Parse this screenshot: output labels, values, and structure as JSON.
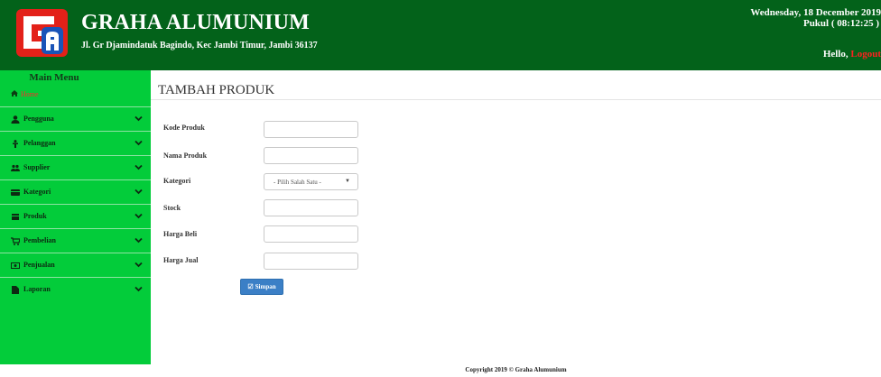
{
  "header": {
    "logo_icon": "graha-alumunium-logo",
    "title": "GRAHA ALUMUNIUM",
    "address": "Jl. Gr Djamindatuk Bagindo, Kec Jambi Timur, Jambi 36137",
    "date": "Wednesday, 18 December 2019",
    "time": "Pukul ( 08:12:25 )",
    "hello": "Hello,",
    "logout": "Logout",
    "colors": {
      "bar": "#03621a",
      "text": "#ffffff",
      "logout": "#ff2020"
    }
  },
  "sidebar": {
    "title": "Main Menu",
    "home": {
      "label": "Home",
      "icon": "home-icon",
      "color": "#ff2a2a"
    },
    "items": [
      {
        "label": "Pengguna",
        "icon": "user-icon"
      },
      {
        "label": "Pelanggan",
        "icon": "person-icon"
      },
      {
        "label": "Supplier",
        "icon": "users-icon"
      },
      {
        "label": "Kategori",
        "icon": "tag-icon"
      },
      {
        "label": "Produk",
        "icon": "box-icon"
      },
      {
        "label": "Pembelian",
        "icon": "cart-icon"
      },
      {
        "label": "Penjualan",
        "icon": "money-icon"
      },
      {
        "label": "Laporan",
        "icon": "file-icon"
      }
    ],
    "colors": {
      "background": "#03cc3a"
    }
  },
  "main": {
    "title": "TAMBAH PRODUK",
    "form": {
      "kode_label": "Kode Produk",
      "kode_value": "",
      "nama_label": "Nama Produk",
      "nama_value": "",
      "kategori_label": "Kategori",
      "kategori_selected": "- Pilih Salah Satu -",
      "stock_label": "Stock",
      "stock_value": "",
      "harga_beli_label": "Harga Beli",
      "harga_beli_value": "",
      "harga_jual_label": "Harga Jual",
      "harga_jual_value": "",
      "save_label": "Simpan"
    },
    "colors": {
      "button": "#3b7fc6"
    }
  },
  "footer": {
    "text": "Copyright 2019 © Graha Alumunium"
  }
}
